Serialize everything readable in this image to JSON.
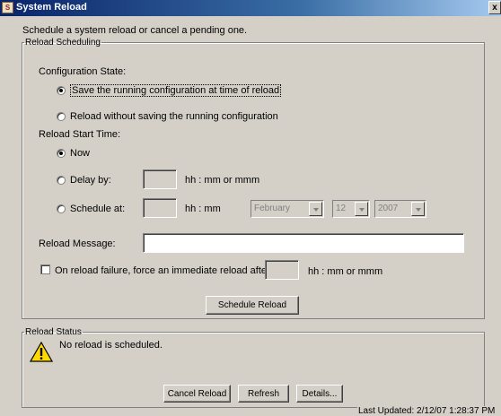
{
  "window": {
    "title": "System Reload",
    "icon": "system-app-icon",
    "close_glyph": "x"
  },
  "intro": "Schedule a system reload or cancel a pending one.",
  "scheduling": {
    "legend": "Reload Scheduling",
    "config_state_label": "Configuration State:",
    "options": [
      {
        "label": "Save the running configuration at time of reload",
        "selected": true
      },
      {
        "label": "Reload without saving the running configuration",
        "selected": false
      }
    ],
    "start_time_label": "Reload Start Time:",
    "now_label": "Now",
    "now_selected": true,
    "delay_label": "Delay by:",
    "delay_value": "",
    "delay_units": "hh : mm or mmm",
    "schedule_label": "Schedule at:",
    "schedule_value": "",
    "schedule_units": "hh : mm",
    "month": "February",
    "day": "12",
    "year": "2007",
    "message_label": "Reload Message:",
    "message_value": "",
    "failure_label": "On reload failure, force an immediate reload after:",
    "failure_checked": false,
    "failure_value": "",
    "failure_units": "hh : mm or mmm",
    "schedule_button": "Schedule Reload"
  },
  "status": {
    "legend": "Reload Status",
    "message": "No reload is scheduled.",
    "cancel_button": "Cancel Reload",
    "refresh_button": "Refresh",
    "details_button": "Details...",
    "last_updated": "Last Updated: 2/12/07 1:28:37 PM"
  }
}
